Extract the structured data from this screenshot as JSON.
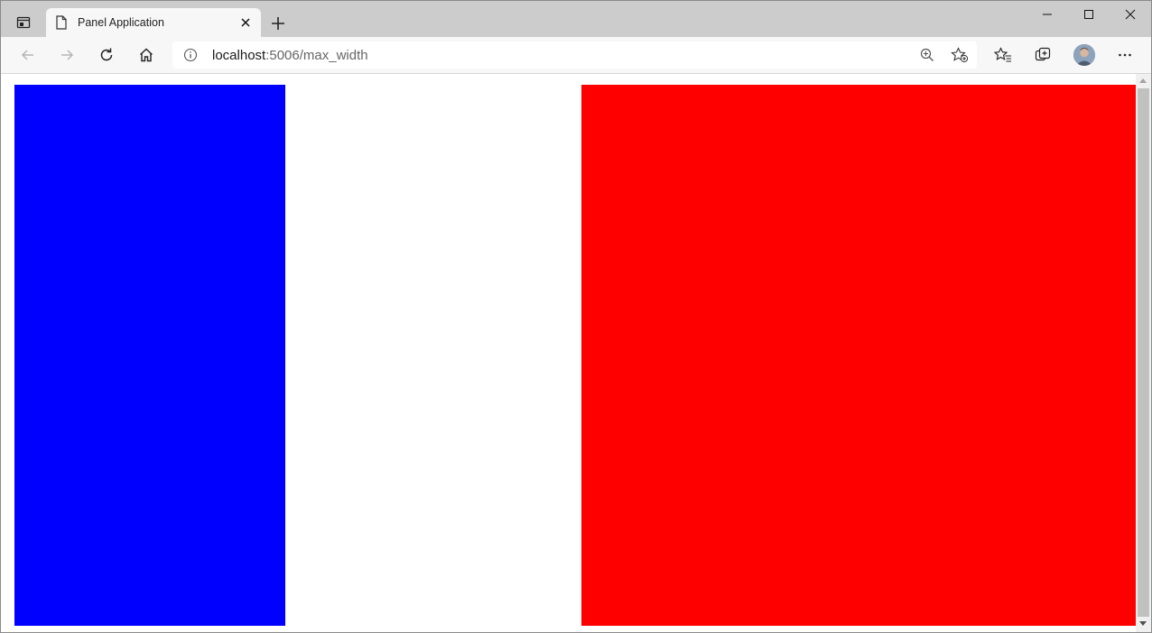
{
  "tab": {
    "title": "Panel Application"
  },
  "address": {
    "host": "localhost",
    "rest": ":5006/max_width"
  },
  "panels": {
    "left_color": "#0000ff",
    "right_color": "#ff0000"
  },
  "icons": {
    "tab_actions": "tab-actions-icon",
    "page": "document-icon",
    "close": "close-icon",
    "new_tab": "plus-icon",
    "back": "back-arrow-icon",
    "forward": "forward-arrow-icon",
    "refresh": "refresh-icon",
    "home": "home-icon",
    "info": "info-icon",
    "zoom": "zoom-icon",
    "add_favorite": "add-favorite-icon",
    "favorites": "favorites-icon",
    "collections": "collections-icon",
    "more": "more-icon"
  }
}
